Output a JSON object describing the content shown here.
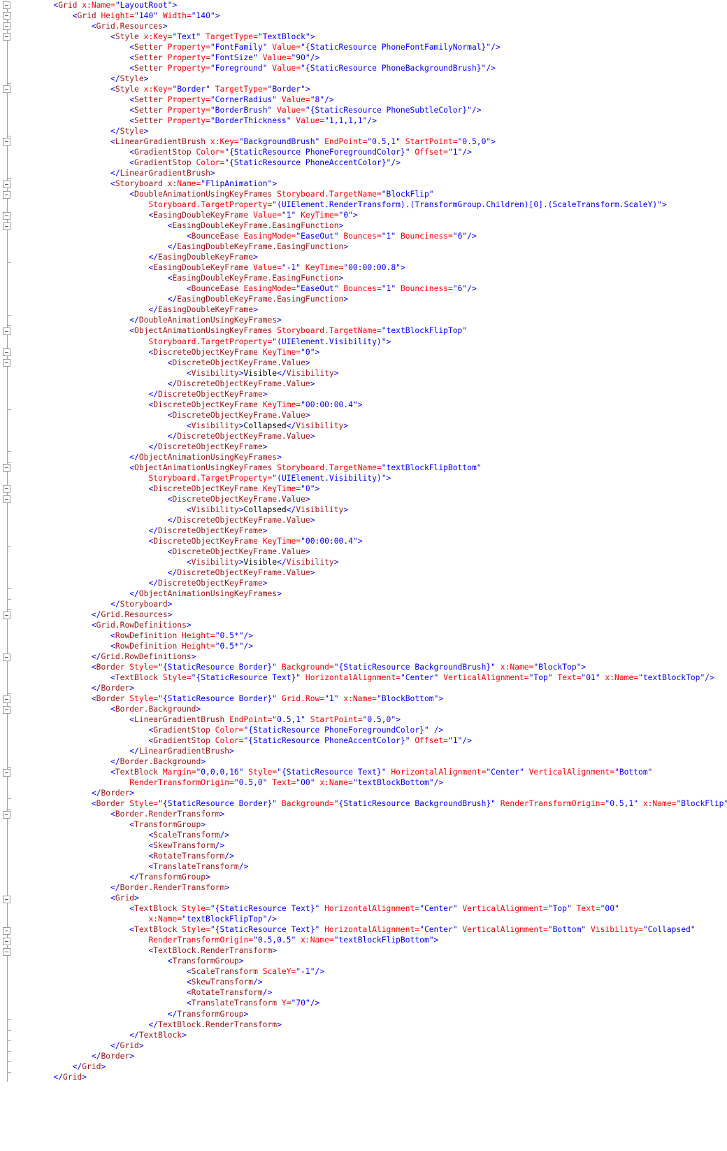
{
  "editor": {
    "app": "xaml-code-editor",
    "language": "XAML",
    "colors": {
      "tag": "#A31515",
      "punctuation": "#0000FF",
      "attribute_name": "#FF0000",
      "attribute_value": "#0000FF",
      "background": "#FFFFFF",
      "gutter_line": "#A0A0A0",
      "fold_box_border": "#9A9A9A"
    },
    "font_size_px": 11.3,
    "line_height_px": 15.03
  },
  "code_lines": [
    {
      "indent": 2,
      "text": "<Grid x:Name=\"LayoutRoot\">"
    },
    {
      "indent": 3,
      "text": "<Grid Height=\"140\" Width=\"140\">"
    },
    {
      "indent": 4,
      "text": "<Grid.Resources>"
    },
    {
      "indent": 5,
      "text": "<Style x:Key=\"Text\" TargetType=\"TextBlock\">"
    },
    {
      "indent": 6,
      "text": "<Setter Property=\"FontFamily\" Value=\"{StaticResource PhoneFontFamilyNormal}\"/>"
    },
    {
      "indent": 6,
      "text": "<Setter Property=\"FontSize\" Value=\"90\"/>"
    },
    {
      "indent": 6,
      "text": "<Setter Property=\"Foreground\" Value=\"{StaticResource PhoneBackgroundBrush}\"/>"
    },
    {
      "indent": 5,
      "text": "</Style>"
    },
    {
      "indent": 5,
      "text": "<Style x:Key=\"Border\" TargetType=\"Border\">"
    },
    {
      "indent": 6,
      "text": "<Setter Property=\"CornerRadius\" Value=\"8\"/>"
    },
    {
      "indent": 6,
      "text": "<Setter Property=\"BorderBrush\" Value=\"{StaticResource PhoneSubtleColor}\"/>"
    },
    {
      "indent": 6,
      "text": "<Setter Property=\"BorderThickness\" Value=\"1,1,1,1\"/>"
    },
    {
      "indent": 5,
      "text": "</Style>"
    },
    {
      "indent": 5,
      "text": "<LinearGradientBrush x:Key=\"BackgroundBrush\" EndPoint=\"0.5,1\" StartPoint=\"0.5,0\">"
    },
    {
      "indent": 6,
      "text": "<GradientStop Color=\"{StaticResource PhoneForegroundColor}\" Offset=\"1\"/>"
    },
    {
      "indent": 6,
      "text": "<GradientStop Color=\"{StaticResource PhoneAccentColor}\"/>"
    },
    {
      "indent": 5,
      "text": "</LinearGradientBrush>"
    },
    {
      "indent": 5,
      "text": "<Storyboard x:Name=\"FlipAnimation\">"
    },
    {
      "indent": 6,
      "text": "<DoubleAnimationUsingKeyFrames Storyboard.TargetName=\"BlockFlip\""
    },
    {
      "indent": 7,
      "text": "Storyboard.TargetProperty=\"(UIElement.RenderTransform).(TransformGroup.Children)[0].(ScaleTransform.ScaleY)\">"
    },
    {
      "indent": 7,
      "text": "<EasingDoubleKeyFrame Value=\"1\" KeyTime=\"0\">"
    },
    {
      "indent": 8,
      "text": "<EasingDoubleKeyFrame.EasingFunction>"
    },
    {
      "indent": 9,
      "text": "<BounceEase EasingMode=\"EaseOut\" Bounces=\"1\" Bounciness=\"6\"/>"
    },
    {
      "indent": 8,
      "text": "</EasingDoubleKeyFrame.EasingFunction>"
    },
    {
      "indent": 7,
      "text": "</EasingDoubleKeyFrame>"
    },
    {
      "indent": 7,
      "text": "<EasingDoubleKeyFrame Value=\"-1\" KeyTime=\"00:00:00.8\">"
    },
    {
      "indent": 8,
      "text": "<EasingDoubleKeyFrame.EasingFunction>"
    },
    {
      "indent": 9,
      "text": "<BounceEase EasingMode=\"EaseOut\" Bounces=\"1\" Bounciness=\"6\"/>"
    },
    {
      "indent": 8,
      "text": "</EasingDoubleKeyFrame.EasingFunction>"
    },
    {
      "indent": 7,
      "text": "</EasingDoubleKeyFrame>"
    },
    {
      "indent": 6,
      "text": "</DoubleAnimationUsingKeyFrames>"
    },
    {
      "indent": 6,
      "text": "<ObjectAnimationUsingKeyFrames Storyboard.TargetName=\"textBlockFlipTop\""
    },
    {
      "indent": 7,
      "text": "Storyboard.TargetProperty=\"(UIElement.Visibility)\">"
    },
    {
      "indent": 7,
      "text": "<DiscreteObjectKeyFrame KeyTime=\"0\">"
    },
    {
      "indent": 8,
      "text": "<DiscreteObjectKeyFrame.Value>"
    },
    {
      "indent": 9,
      "text": "<Visibility>Visible</Visibility>"
    },
    {
      "indent": 8,
      "text": "</DiscreteObjectKeyFrame.Value>"
    },
    {
      "indent": 7,
      "text": "</DiscreteObjectKeyFrame>"
    },
    {
      "indent": 7,
      "text": "<DiscreteObjectKeyFrame KeyTime=\"00:00:00.4\">"
    },
    {
      "indent": 8,
      "text": "<DiscreteObjectKeyFrame.Value>"
    },
    {
      "indent": 9,
      "text": "<Visibility>Collapsed</Visibility>"
    },
    {
      "indent": 8,
      "text": "</DiscreteObjectKeyFrame.Value>"
    },
    {
      "indent": 7,
      "text": "</DiscreteObjectKeyFrame>"
    },
    {
      "indent": 6,
      "text": "</ObjectAnimationUsingKeyFrames>"
    },
    {
      "indent": 6,
      "text": "<ObjectAnimationUsingKeyFrames Storyboard.TargetName=\"textBlockFlipBottom\""
    },
    {
      "indent": 7,
      "text": "Storyboard.TargetProperty=\"(UIElement.Visibility)\">"
    },
    {
      "indent": 7,
      "text": "<DiscreteObjectKeyFrame KeyTime=\"0\">"
    },
    {
      "indent": 8,
      "text": "<DiscreteObjectKeyFrame.Value>"
    },
    {
      "indent": 9,
      "text": "<Visibility>Collapsed</Visibility>"
    },
    {
      "indent": 8,
      "text": "</DiscreteObjectKeyFrame.Value>"
    },
    {
      "indent": 7,
      "text": "</DiscreteObjectKeyFrame>"
    },
    {
      "indent": 7,
      "text": "<DiscreteObjectKeyFrame KeyTime=\"00:00:00.4\">"
    },
    {
      "indent": 8,
      "text": "<DiscreteObjectKeyFrame.Value>"
    },
    {
      "indent": 9,
      "text": "<Visibility>Visible</Visibility>"
    },
    {
      "indent": 8,
      "text": "</DiscreteObjectKeyFrame.Value>"
    },
    {
      "indent": 7,
      "text": "</DiscreteObjectKeyFrame>"
    },
    {
      "indent": 6,
      "text": "</ObjectAnimationUsingKeyFrames>"
    },
    {
      "indent": 5,
      "text": "</Storyboard>"
    },
    {
      "indent": 4,
      "text": "</Grid.Resources>"
    },
    {
      "indent": 4,
      "text": "<Grid.RowDefinitions>"
    },
    {
      "indent": 5,
      "text": "<RowDefinition Height=\"0.5*\"/>"
    },
    {
      "indent": 5,
      "text": "<RowDefinition Height=\"0.5*\"/>"
    },
    {
      "indent": 4,
      "text": "</Grid.RowDefinitions>"
    },
    {
      "indent": 4,
      "text": "<Border Style=\"{StaticResource Border}\" Background=\"{StaticResource BackgroundBrush}\" x:Name=\"BlockTop\">"
    },
    {
      "indent": 5,
      "text": "<TextBlock Style=\"{StaticResource Text}\" HorizontalAlignment=\"Center\" VerticalAlignment=\"Top\" Text=\"01\" x:Name=\"textBlockTop\"/>"
    },
    {
      "indent": 4,
      "text": "</Border>"
    },
    {
      "indent": 4,
      "text": "<Border Style=\"{StaticResource Border}\" Grid.Row=\"1\" x:Name=\"BlockBottom\">"
    },
    {
      "indent": 5,
      "text": "<Border.Background>"
    },
    {
      "indent": 6,
      "text": "<LinearGradientBrush EndPoint=\"0.5,1\" StartPoint=\"0.5,0\">"
    },
    {
      "indent": 7,
      "text": "<GradientStop Color=\"{StaticResource PhoneForegroundColor}\" />"
    },
    {
      "indent": 7,
      "text": "<GradientStop Color=\"{StaticResource PhoneAccentColor}\" Offset=\"1\"/>"
    },
    {
      "indent": 6,
      "text": "</LinearGradientBrush>"
    },
    {
      "indent": 5,
      "text": "</Border.Background>"
    },
    {
      "indent": 5,
      "text": "<TextBlock Margin=\"0,0,0,16\" Style=\"{StaticResource Text}\" HorizontalAlignment=\"Center\" VerticalAlignment=\"Bottom\""
    },
    {
      "indent": 6,
      "text": "RenderTransformOrigin=\"0.5,0\" Text=\"00\" x:Name=\"textBlockBottom\"/>"
    },
    {
      "indent": 4,
      "text": "</Border>"
    },
    {
      "indent": 4,
      "text": "<Border Style=\"{StaticResource Border}\" Background=\"{StaticResource BackgroundBrush}\" RenderTransformOrigin=\"0.5,1\" x:Name=\"BlockFlip\">"
    },
    {
      "indent": 5,
      "text": "<Border.RenderTransform>"
    },
    {
      "indent": 6,
      "text": "<TransformGroup>"
    },
    {
      "indent": 7,
      "text": "<ScaleTransform/>"
    },
    {
      "indent": 7,
      "text": "<SkewTransform/>"
    },
    {
      "indent": 7,
      "text": "<RotateTransform/>"
    },
    {
      "indent": 7,
      "text": "<TranslateTransform/>"
    },
    {
      "indent": 6,
      "text": "</TransformGroup>"
    },
    {
      "indent": 5,
      "text": "</Border.RenderTransform>"
    },
    {
      "indent": 5,
      "text": "<Grid>"
    },
    {
      "indent": 6,
      "text": "<TextBlock Style=\"{StaticResource Text}\" HorizontalAlignment=\"Center\" VerticalAlignment=\"Top\" Text=\"00\""
    },
    {
      "indent": 7,
      "text": "x:Name=\"textBlockFlipTop\"/>"
    },
    {
      "indent": 6,
      "text": "<TextBlock Style=\"{StaticResource Text}\" HorizontalAlignment=\"Center\" VerticalAlignment=\"Bottom\" Visibility=\"Collapsed\""
    },
    {
      "indent": 7,
      "text": "RenderTransformOrigin=\"0.5,0.5\" x:Name=\"textBlockFlipBottom\">"
    },
    {
      "indent": 7,
      "text": "<TextBlock.RenderTransform>"
    },
    {
      "indent": 8,
      "text": "<TransformGroup>"
    },
    {
      "indent": 9,
      "text": "<ScaleTransform ScaleY=\"-1\"/>"
    },
    {
      "indent": 9,
      "text": "<SkewTransform/>"
    },
    {
      "indent": 9,
      "text": "<RotateTransform/>"
    },
    {
      "indent": 9,
      "text": "<TranslateTransform Y=\"70\"/>"
    },
    {
      "indent": 8,
      "text": "</TransformGroup>"
    },
    {
      "indent": 7,
      "text": "</TextBlock.RenderTransform>"
    },
    {
      "indent": 6,
      "text": "</TextBlock>"
    },
    {
      "indent": 5,
      "text": "</Grid>"
    },
    {
      "indent": 4,
      "text": "</Border>"
    },
    {
      "indent": 3,
      "text": "</Grid>"
    },
    {
      "indent": 2,
      "text": "</Grid>"
    }
  ],
  "gutter": {
    "fold_boxes_line_indexes": [
      0,
      1,
      2,
      3,
      8,
      13,
      17,
      18,
      20,
      21,
      31,
      33,
      34,
      44,
      46,
      47,
      58,
      62,
      66,
      67,
      73,
      77,
      85,
      88,
      89,
      90
    ],
    "fold_tick_line_indexes": [
      7,
      12,
      16,
      24,
      29,
      30,
      38,
      42,
      43,
      51,
      55,
      56,
      57,
      65,
      72,
      75,
      76,
      96,
      97,
      98,
      99,
      100,
      101
    ]
  }
}
